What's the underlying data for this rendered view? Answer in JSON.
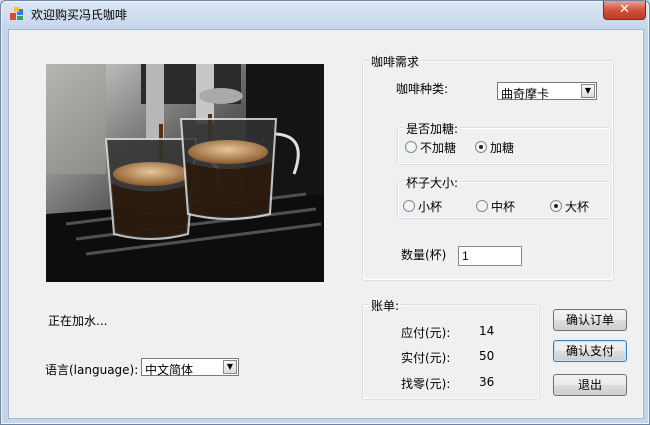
{
  "window": {
    "title": "欢迎购买冯氏咖啡",
    "close": "✕"
  },
  "status": "正在加水...",
  "language": {
    "label": "语言(language):",
    "selected": "中文简体"
  },
  "demand": {
    "title": "咖啡需求",
    "type_label": "咖啡种类:",
    "type_selected": "曲奇摩卡",
    "sugar": {
      "title": "是否加糖:",
      "options": [
        "不加糖",
        "加糖"
      ],
      "selected": 1
    },
    "cup": {
      "title": "杯子大小:",
      "options": [
        "小杯",
        "中杯",
        "大杯"
      ],
      "selected": 2
    },
    "qty_label": "数量(杯)",
    "qty_value": "1"
  },
  "bill": {
    "title": "账单:",
    "rows": [
      {
        "label": "应付(元):",
        "value": "14"
      },
      {
        "label": "实付(元):",
        "value": "50"
      },
      {
        "label": "找零(元):",
        "value": "36"
      }
    ]
  },
  "buttons": {
    "confirm_order": "确认订单",
    "confirm_pay": "确认支付",
    "exit": "退出"
  }
}
